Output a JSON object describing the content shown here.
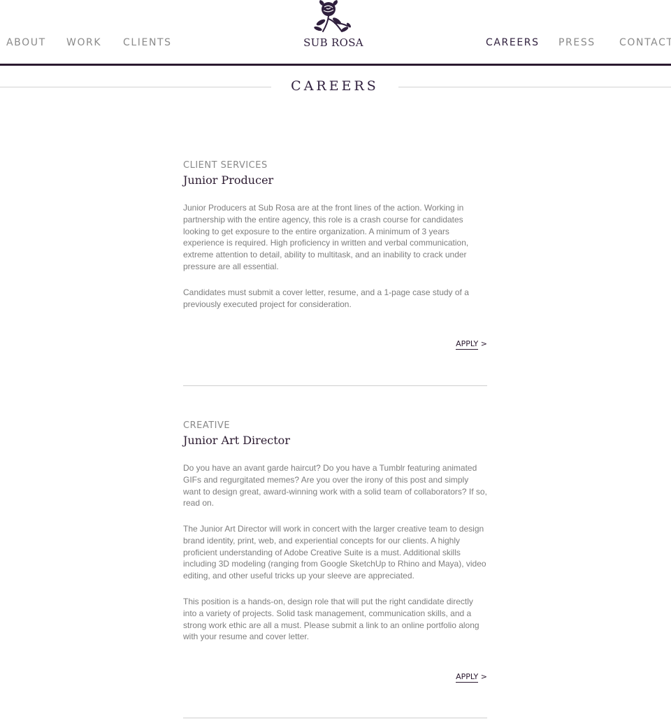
{
  "nav": {
    "left": [
      {
        "label": "ABOUT"
      },
      {
        "label": "WORK"
      },
      {
        "label": "CLIENTS"
      }
    ],
    "right": [
      {
        "label": "CAREERS"
      },
      {
        "label": "PRESS"
      },
      {
        "label": "CONTACT"
      }
    ],
    "active": "CAREERS"
  },
  "logo": {
    "text": "SUB ROSA",
    "icon": "rose-icon"
  },
  "page": {
    "title": "CAREERS"
  },
  "jobs": [
    {
      "department": "CLIENT SERVICES",
      "title": "Junior Producer",
      "paragraphs": [
        "Junior Producers at Sub Rosa are at the front lines of the action. Working in partnership with the entire agency, this role is a crash course for candidates looking to get exposure to the entire organization. A minimum of 3 years experience is required. High proficiency in written and verbal communication, extreme attention to detail, ability to multitask, and an inability to crack under pressure are all essential.",
        "Candidates must submit a cover letter, resume, and a 1-page case study of a previously executed project for consideration."
      ],
      "apply_label": "APPLY",
      "apply_arrow": ">"
    },
    {
      "department": "CREATIVE",
      "title": "Junior Art Director",
      "paragraphs": [
        "Do you have an avant garde haircut? Do you have a Tumblr featuring animated GIFs and regurgitated memes? Are you over the irony of this post and simply want to design great, award-winning work with a solid team of collaborators? If so, read on.",
        "The Junior Art Director will work in concert with the larger creative team to design brand identity, print, web, and experiential concepts for our clients. A highly proficient understanding of Adobe Creative Suite is a must. Additional skills including 3D modeling (ranging from Google SketchUp to Rhino and Maya), video editing, and other useful tricks up your sleeve are appreciated.",
        "This position is a hands-on, design role that will put the right candidate directly into a variety of projects. Solid task management, communication skills, and a strong work ethic are all a must. Please submit a link to an online portfolio along with your resume and cover letter."
      ],
      "apply_label": "APPLY",
      "apply_arrow": ">"
    }
  ],
  "colors": {
    "accent": "#2f1f3d",
    "text": "#7d7d7d",
    "nav": "#8a8a8a",
    "divider": "#cfcfcf"
  }
}
